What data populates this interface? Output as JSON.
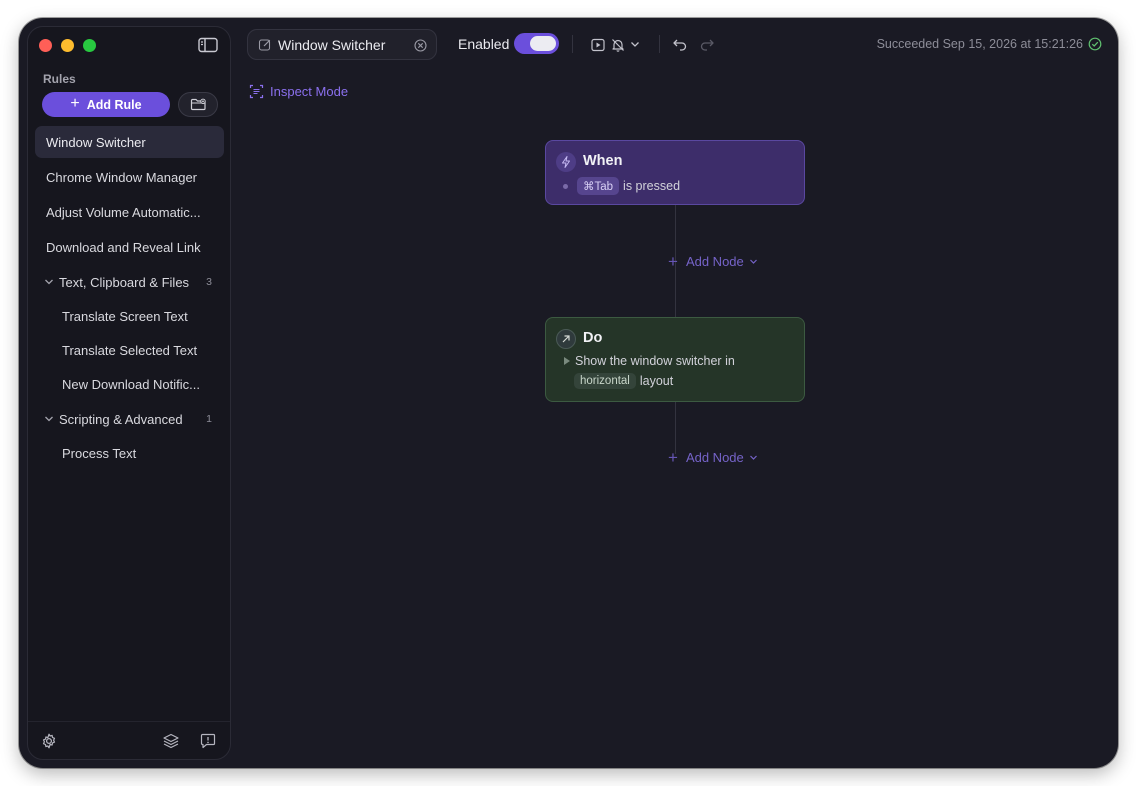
{
  "sidebar": {
    "heading": "Rules",
    "add_rule_label": "Add Rule",
    "items": [
      {
        "label": "Window Switcher",
        "active": true
      },
      {
        "label": "Chrome Window Manager"
      },
      {
        "label": "Adjust Volume Automatic..."
      },
      {
        "label": "Download and Reveal Link"
      }
    ],
    "groups": [
      {
        "label": "Text, Clipboard & Files",
        "count": "3",
        "items": [
          "Translate Screen Text",
          "Translate Selected Text",
          "New Download Notific..."
        ]
      },
      {
        "label": "Scripting & Advanced",
        "count": "1",
        "items": [
          "Process Text"
        ]
      }
    ],
    "footer_icons": [
      "gear-icon",
      "layers-icon",
      "feedback-icon"
    ]
  },
  "toolbar": {
    "title": "Window Switcher",
    "enabled_label": "Enabled",
    "enabled": true,
    "status": "Succeeded Sep 15, 2026 at 15:21:26"
  },
  "canvas": {
    "inspect_label": "Inspect Mode",
    "add_node_label": "Add Node",
    "when_node": {
      "title": "When",
      "chip": "⌘Tab",
      "text": "is pressed"
    },
    "do_node": {
      "title": "Do",
      "line1": "Show the window switcher in",
      "chip": "horizontal",
      "line2": "layout"
    }
  },
  "colors": {
    "accent": "#6b4fdc",
    "when_bg": "#3d2d6a",
    "do_bg": "#253528",
    "window_bg": "#1a1a24"
  }
}
